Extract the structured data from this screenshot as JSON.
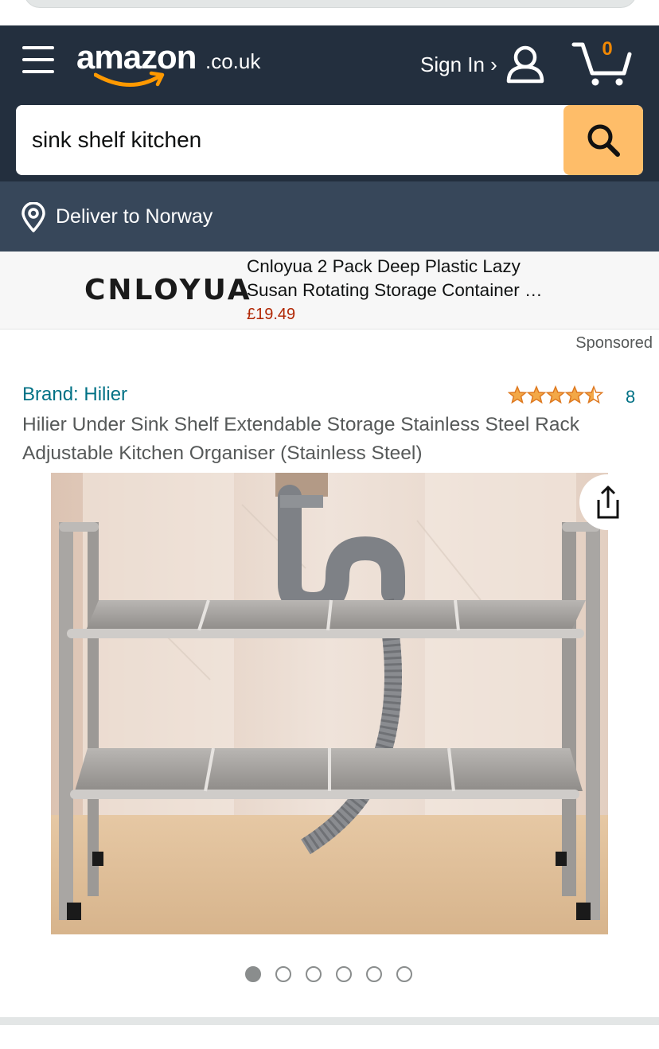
{
  "header": {
    "logo_word": "amazon",
    "logo_tld": ".co.uk",
    "sign_in": "Sign In ›",
    "cart_count": "0"
  },
  "search": {
    "value": "sink shelf kitchen"
  },
  "delivery": {
    "text": "Deliver to Norway"
  },
  "sponsored_ad": {
    "brand_logo": "CNLOYUA",
    "title_line1": "Cnloyua 2 Pack Deep Plastic Lazy",
    "title_line2": "Susan Rotating Storage Container …",
    "price": "£19.49",
    "label": "Sponsored"
  },
  "product": {
    "brand": "Brand: Hilier",
    "rating": 4.5,
    "rating_count": "8",
    "title": "Hilier Under Sink Shelf Extendable Storage Stainless Steel Rack Adjustable Kitchen Organiser (Stainless Steel)"
  },
  "carousel": {
    "total": 6,
    "active": 1
  },
  "colors": {
    "header_bg": "#232f3e",
    "delivery_bg": "#37475a",
    "search_button": "#febd69",
    "link": "#007185",
    "price": "#b12704",
    "star": "#f3a847",
    "cart_count": "#f08804"
  },
  "icons": [
    "menu-icon",
    "user-icon",
    "cart-icon",
    "search-icon",
    "location-pin-icon",
    "share-icon",
    "star-icon"
  ]
}
